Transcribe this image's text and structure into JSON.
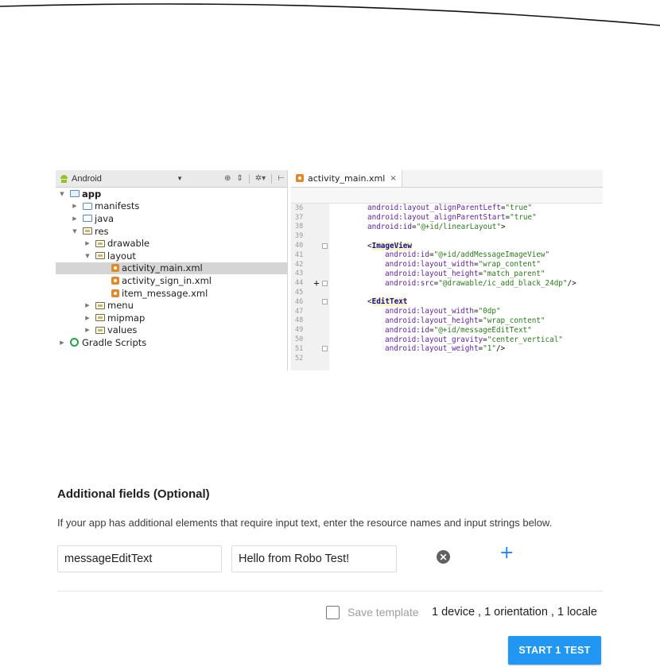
{
  "ide": {
    "project_view": "Android",
    "tree": [
      {
        "label": "app",
        "bold": true
      },
      {
        "label": "manifests"
      },
      {
        "label": "java"
      },
      {
        "label": "res"
      },
      {
        "label": "drawable"
      },
      {
        "label": "layout"
      },
      {
        "label": "activity_main.xml",
        "selected": true
      },
      {
        "label": "activity_sign_in.xml"
      },
      {
        "label": "item_message.xml"
      },
      {
        "label": "menu"
      },
      {
        "label": "mipmap"
      },
      {
        "label": "values"
      },
      {
        "label": "Gradle Scripts"
      }
    ],
    "tab": {
      "label": "activity_main.xml",
      "close": "×"
    },
    "code": [
      {
        "n": "36",
        "attr": "android:layout_alignParentLeft",
        "eq": "=",
        "val": "\"true\"",
        "tail": ""
      },
      {
        "n": "37",
        "attr": "android:layout_alignParentStart",
        "eq": "=",
        "val": "\"true\"",
        "tail": ""
      },
      {
        "n": "38",
        "attr": "android:id",
        "eq": "=",
        "val": "\"@+id/linearLayout\"",
        "tail": ">"
      },
      {
        "n": "39"
      },
      {
        "n": "40",
        "tag": "ImageView"
      },
      {
        "n": "41",
        "attr": "android:id",
        "eq": "=",
        "val": "\"@+id/addMessageImageView\"",
        "tail": ""
      },
      {
        "n": "42",
        "attr": "android:layout_width",
        "eq": "=",
        "val": "\"wrap_content\"",
        "tail": ""
      },
      {
        "n": "43",
        "attr": "android:layout_height",
        "eq": "=",
        "val": "\"match_parent\"",
        "tail": ""
      },
      {
        "n": "44",
        "attr": "android:src",
        "eq": "=",
        "val": "\"@drawable/ic_add_black_24dp\"",
        "tail": "/>",
        "marker": "+"
      },
      {
        "n": "45"
      },
      {
        "n": "46",
        "tag": "EditText"
      },
      {
        "n": "47",
        "attr": "android:layout_width",
        "eq": "=",
        "val": "\"0dp\"",
        "tail": ""
      },
      {
        "n": "48",
        "attr": "android:layout_height",
        "eq": "=",
        "val": "\"wrap_content\"",
        "tail": ""
      },
      {
        "n": "49",
        "attr": "android:id",
        "eq": "=",
        "val": "\"@+id/messageEditText\"",
        "tail": ""
      },
      {
        "n": "50",
        "attr": "android:layout_gravity",
        "eq": "=",
        "val": "\"center_vertical\"",
        "tail": ""
      },
      {
        "n": "51",
        "attr": "android:layout_weight",
        "eq": "=",
        "val": "\"1\"",
        "tail": "/>"
      },
      {
        "n": "52"
      }
    ]
  },
  "additional_fields": {
    "title": "Additional fields (Optional)",
    "description": "If your app has additional elements that require input text, enter the resource names and input strings below.",
    "resource_name": "messageEditText",
    "input_string": "Hello from Robo Test!"
  },
  "footer": {
    "save_template": "Save template",
    "summary": "1 device , 1 orientation , 1 locale",
    "start_button": "START 1 TEST"
  },
  "colors": {
    "accent": "#2196f3",
    "add_icon": "#1e88e5"
  }
}
